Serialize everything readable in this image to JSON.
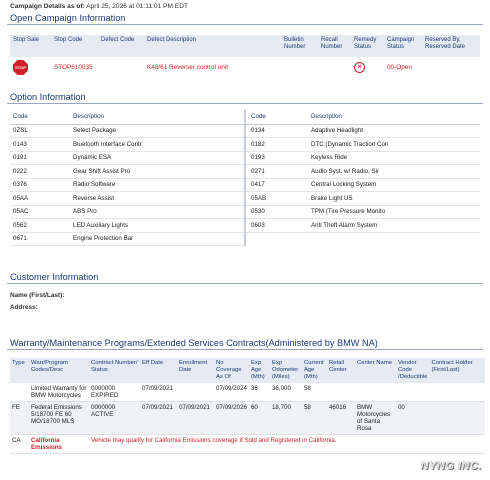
{
  "header": {
    "label": "Campaign Details as of:",
    "timestamp": "April 25, 2026 at 01:11:01 PM EDT"
  },
  "campaign": {
    "title": "Open Campaign Information",
    "columns": [
      "Stop Sale",
      "Stop Code",
      "Defect Code",
      "Defect Description",
      "Bulletin Number",
      "Recall Number",
      "Remedy Status",
      "Campaign Status",
      "Reserved By, Reserved Date"
    ],
    "row": {
      "stop_sale_icon": "stop",
      "stop_code": "STOP610035",
      "defect_code": "",
      "defect_description": "K48/61 Reverser control unit",
      "bulletin_number": "",
      "recall_number": "",
      "remedy_status_icon": "x-circle-icon",
      "campaign_status": "00-Open",
      "reserved": ""
    }
  },
  "options": {
    "title": "Option Information",
    "col_code": "Code",
    "col_desc": "Description",
    "left": [
      {
        "code": "0ZSL",
        "desc": "Select Package"
      },
      {
        "code": "0143",
        "desc": "Bluetooth Interface Contr"
      },
      {
        "code": "0191",
        "desc": "Dynamic ESA"
      },
      {
        "code": "0222",
        "desc": "Gear Shift Assist Pro"
      },
      {
        "code": "0376",
        "desc": "Radio Software"
      },
      {
        "code": "05AA",
        "desc": "Reverse Assist"
      },
      {
        "code": "05AC",
        "desc": "ABS Pro"
      },
      {
        "code": "0562",
        "desc": "LED Auxiliary Lights"
      },
      {
        "code": "0671",
        "desc": "Engine Protection Bar"
      }
    ],
    "right": [
      {
        "code": "0134",
        "desc": "Adaptive Headlight"
      },
      {
        "code": "0182",
        "desc": "DTC (Dynamic Traction Con"
      },
      {
        "code": "0193",
        "desc": "Keyless Ride"
      },
      {
        "code": "0271",
        "desc": "Audio Syst. w/ Radio, Sir"
      },
      {
        "code": "0417",
        "desc": "Central Locking System"
      },
      {
        "code": "05AB",
        "desc": "Brake Light US"
      },
      {
        "code": "0530",
        "desc": "TPM (Tire Pressure Monito"
      },
      {
        "code": "0603",
        "desc": "Anti Theft Alarm System"
      }
    ]
  },
  "customer": {
    "title": "Customer Information",
    "name_label": "Name (First/Last):",
    "address_label": "Address:"
  },
  "warranty": {
    "title": "Warranty/Maintenance Programs/Extended Services Contracts(Administered by BMW NA)",
    "columns": [
      "Type",
      "Warr/Program Codes/Desc",
      "Contract Number/ Status",
      "Eff Date",
      "Enrollment Date",
      "No Coverage As Of",
      "Exp Age (Mth)",
      "Exp Odometer (Miles)",
      "Current Age (Mth)",
      "Retail Center",
      "Center Name",
      "Vendor Code /Deductible",
      "Contract Holder (First/Last)"
    ],
    "rows": [
      {
        "type": "",
        "codes": "Limited Warranty for BMW Motorcycles",
        "contract": "0000000 EXPIRED",
        "eff": "07/09/2021",
        "enroll": "",
        "nocov": "07/09/2024",
        "expage": "36",
        "expodo": "36,000",
        "curage": "58",
        "retail": "",
        "center": "",
        "vendor": "",
        "holder": ""
      },
      {
        "type": "FE",
        "codes": "Federal Emissions 5/18700 FE 60 MO/18700 MLS",
        "contract": "0000000 ACTIVE",
        "eff": "07/09/2021",
        "enroll": "07/09/2021",
        "nocov": "07/09/2026",
        "expage": "60",
        "expodo": "18,700",
        "curage": "58",
        "retail": "46016",
        "center": "BMW Motorcycles of Santa Rosa",
        "vendor": "00",
        "holder": ""
      }
    ],
    "ca_row": {
      "type": "CA",
      "codes": "California Emissions",
      "message": "Vehicle may qualify for California Emissions coverage if Sold and Registered in California."
    }
  },
  "watermark": "NYNG INC."
}
